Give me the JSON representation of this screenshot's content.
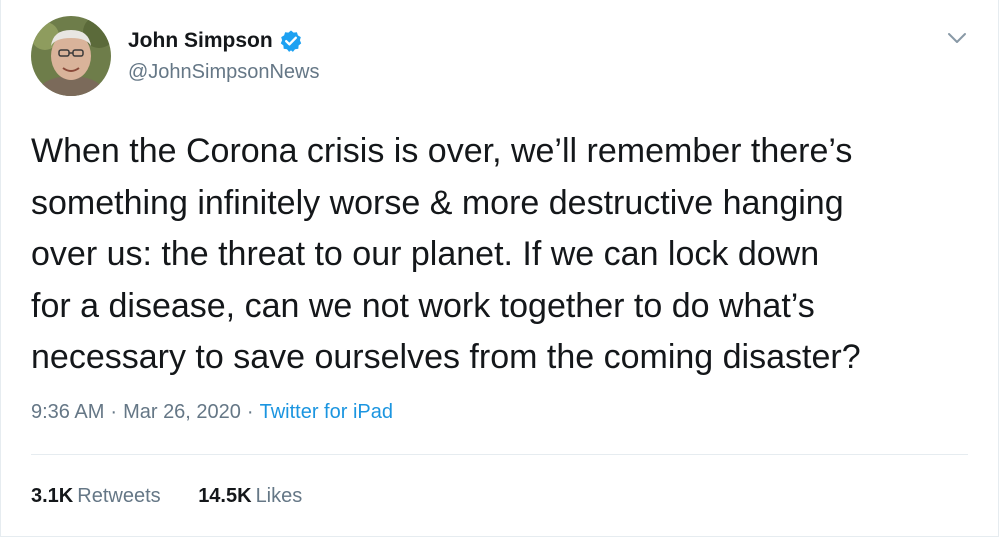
{
  "author": {
    "name": "John Simpson",
    "handle": "@JohnSimpsonNews",
    "verified": true
  },
  "tweet": {
    "lines": [
      "When the Corona crisis is over, we’ll remember there’s",
      "something infinitely worse & more destructive hanging",
      "over us:  the threat to our planet.  If we can lock down",
      "for a disease, can we not work together to do what’s",
      "necessary to save ourselves from the coming disaster?"
    ]
  },
  "meta": {
    "time": "9:36 AM",
    "separator": "·",
    "date": "Mar 26, 2020",
    "source": "Twitter for iPad"
  },
  "stats": {
    "retweets_count": "3.1K",
    "retweets_label": "Retweets",
    "likes_count": "14.5K",
    "likes_label": "Likes"
  },
  "colors": {
    "text": "#14171a",
    "secondary": "#657786",
    "link": "#1b95e0",
    "verified": "#1da1f2",
    "divider": "#e6ecf0"
  },
  "icons": {
    "verified": "verified-badge-icon",
    "menu": "chevron-down-icon"
  }
}
